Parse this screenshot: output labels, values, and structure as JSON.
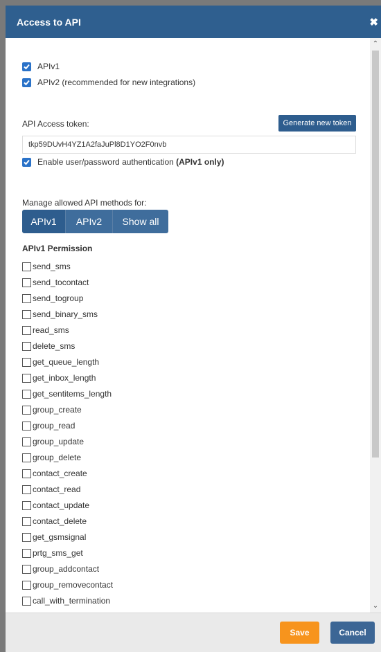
{
  "dialog": {
    "title": "Access to API",
    "close_glyph": "✖"
  },
  "api_versions": [
    {
      "label": "APIv1",
      "checked": true
    },
    {
      "label": "APIv2 (recommended for new integrations)",
      "checked": true
    }
  ],
  "token": {
    "label": "API Access token:",
    "generate_label": "Generate new token",
    "value": "tkp59DUvH4YZ1A2faJuPl8D1YO2F0nvb"
  },
  "auth": {
    "label": "Enable user/password authentication",
    "suffix": "(APIv1 only)",
    "checked": true
  },
  "methods": {
    "label": "Manage allowed API methods for:",
    "tabs": [
      "APIv1",
      "APIv2",
      "Show all"
    ],
    "active_tab": "APIv1"
  },
  "permissions": {
    "title": "APIv1 Permission",
    "items": [
      "send_sms",
      "send_tocontact",
      "send_togroup",
      "send_binary_sms",
      "read_sms",
      "delete_sms",
      "get_queue_length",
      "get_inbox_length",
      "get_sentitems_length",
      "group_create",
      "group_read",
      "group_update",
      "group_delete",
      "contact_create",
      "contact_read",
      "contact_update",
      "contact_delete",
      "get_gsmsignal",
      "prtg_sms_get",
      "group_addcontact",
      "group_removecontact",
      "call_with_termination"
    ]
  },
  "footer": {
    "save_label": "Save",
    "cancel_label": "Cancel"
  },
  "colors": {
    "header": "#2f5f8f",
    "checkbox": "#2a72c8",
    "save": "#f7941d",
    "cancel": "#3c6695"
  }
}
